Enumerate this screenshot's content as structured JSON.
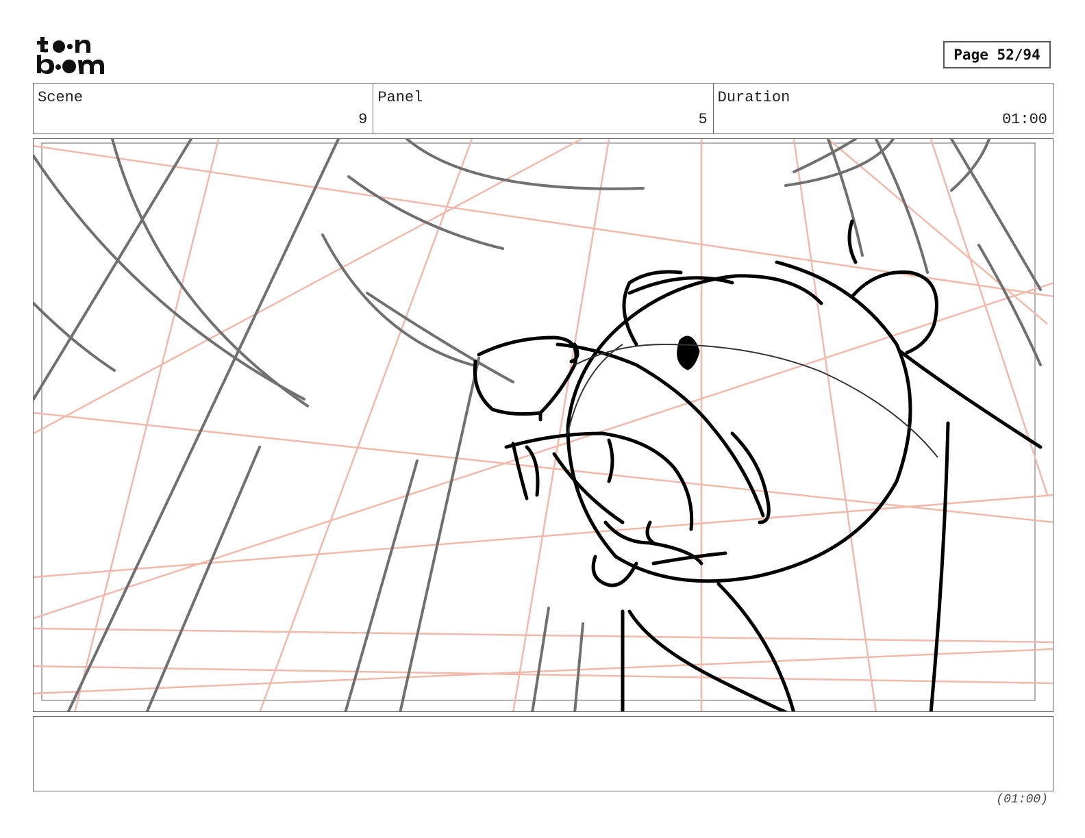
{
  "logo": {
    "line1": "toon",
    "line2": "boom"
  },
  "page": {
    "label": "Page 52/94"
  },
  "info": {
    "scene_label": "Scene",
    "scene_value": "9",
    "panel_label": "Panel",
    "panel_value": "5",
    "duration_label": "Duration",
    "duration_value": "01:00"
  },
  "panel": {
    "content": "storyboard-sketch",
    "ink_color": "#000000",
    "pencil_color": "#707070",
    "guide_color": "#f2b8aa"
  },
  "notes": {
    "text": ""
  },
  "footer": {
    "duration": "(01:00)"
  }
}
